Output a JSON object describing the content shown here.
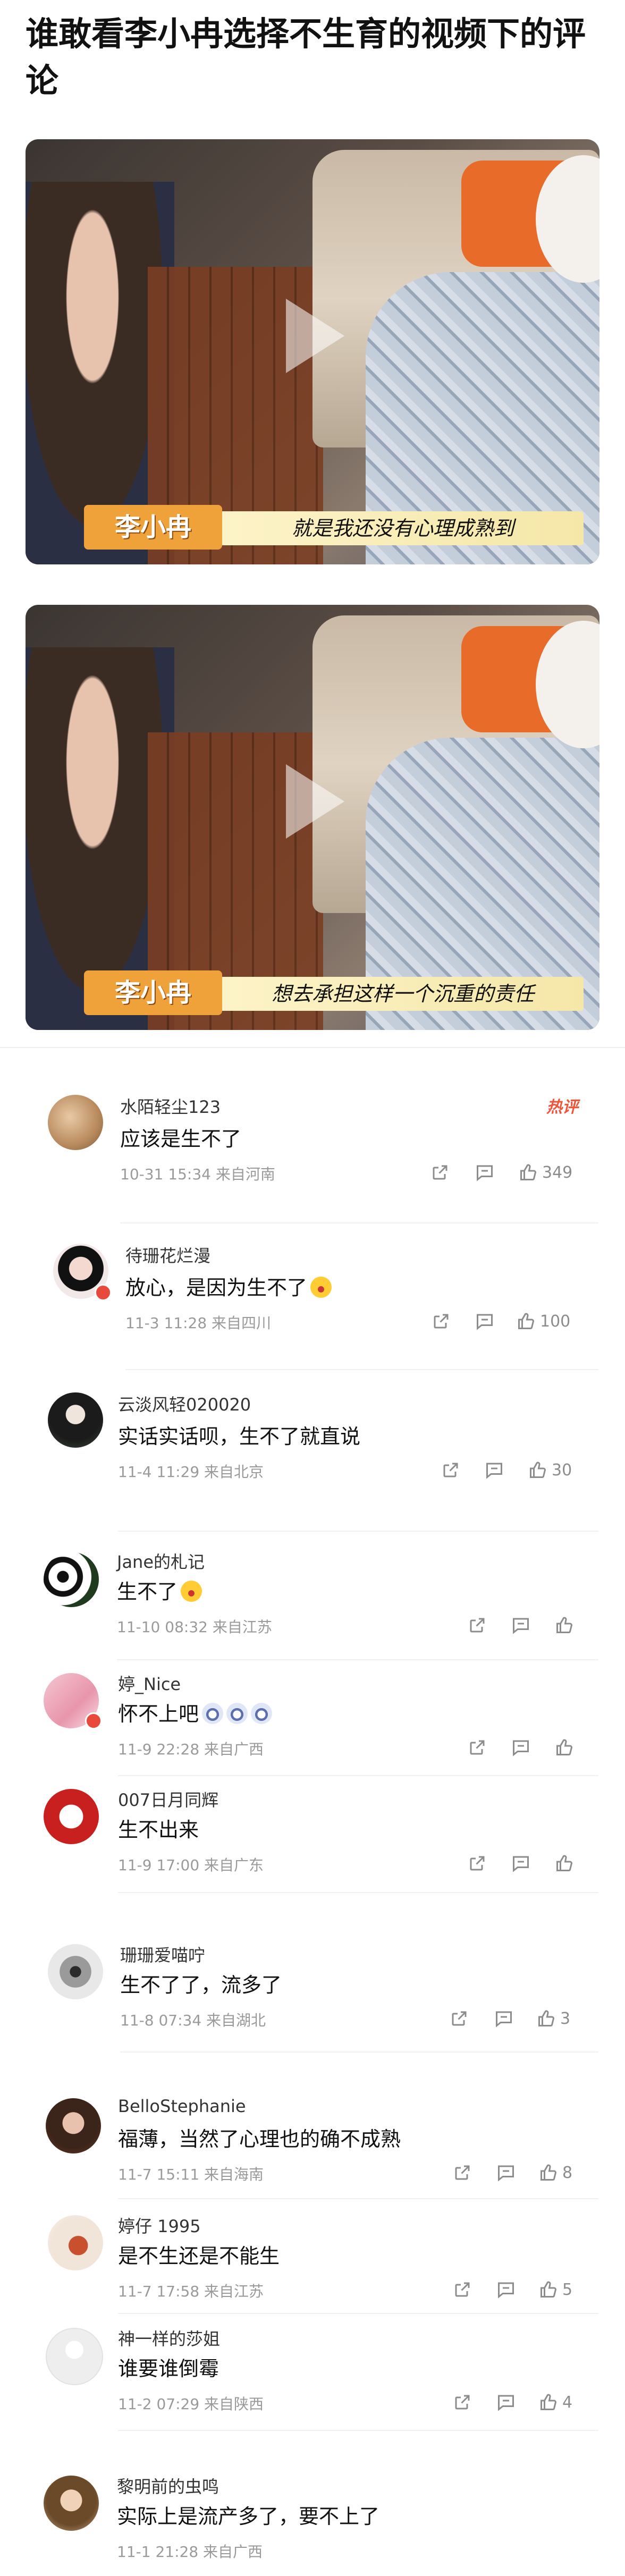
{
  "article": {
    "title": "谁敢看李小冉选择不生育的视频下的评论"
  },
  "videos": [
    {
      "speaker": "李小冉",
      "subtitle": "就是我还没有心理成熟到"
    },
    {
      "speaker": "李小冉",
      "subtitle": "想去承担这样一个沉重的责任"
    }
  ],
  "comments": [
    {
      "user": "水陌轻尘123",
      "text": "应该是生不了",
      "time": "10-31 15:34",
      "location": "来自河南",
      "likes": "349",
      "hot_tag": "热评"
    },
    {
      "user": "待珊花烂漫",
      "text": "放心，是因为生不了",
      "time": "11-3 11:28",
      "location": "来自四川",
      "likes": "100"
    },
    {
      "user": "云淡风轻020020",
      "text": "实话实话呗，生不了就直说",
      "time": "11-4 11:29",
      "location": "来自北京",
      "likes": "30"
    },
    {
      "user": "Jane的札记",
      "text": "生不了",
      "time": "11-10 08:32",
      "location": "来自江苏",
      "likes": ""
    },
    {
      "user": "婷_Nice",
      "text": "怀不上吧",
      "time": "11-9 22:28",
      "location": "来自广西",
      "likes": ""
    },
    {
      "user": "007日月同辉",
      "text": "生不出来",
      "time": "11-9 17:00",
      "location": "来自广东",
      "likes": ""
    },
    {
      "user": "珊珊爱喵咛",
      "text": "生不了了，流多了",
      "time": "11-8 07:34",
      "location": "来自湖北",
      "likes": "3"
    },
    {
      "user": "BelloStephanie",
      "text": "福薄，当然了心理也的确不成熟",
      "time": "11-7 15:11",
      "location": "来自海南",
      "likes": "8"
    },
    {
      "user": "婷仔 1995",
      "text": "是不生还是不能生",
      "time": "11-7 17:58",
      "location": "来自江苏",
      "likes": "5"
    },
    {
      "user": "神一样的莎姐",
      "text": "谁要谁倒霉",
      "time": "11-2 07:29",
      "location": "来自陕西",
      "likes": "4"
    },
    {
      "user": "黎明前的虫鸣",
      "text": "实际上是流产多了，要不上了",
      "time": "11-1 21:28",
      "location": "来自广西",
      "likes": ""
    }
  ],
  "icons": {
    "share": "share-icon",
    "comment": "comment-icon",
    "like": "thumbs-up-icon"
  },
  "colors": {
    "hot": "#f0553c",
    "meta": "#9a9a9a"
  }
}
